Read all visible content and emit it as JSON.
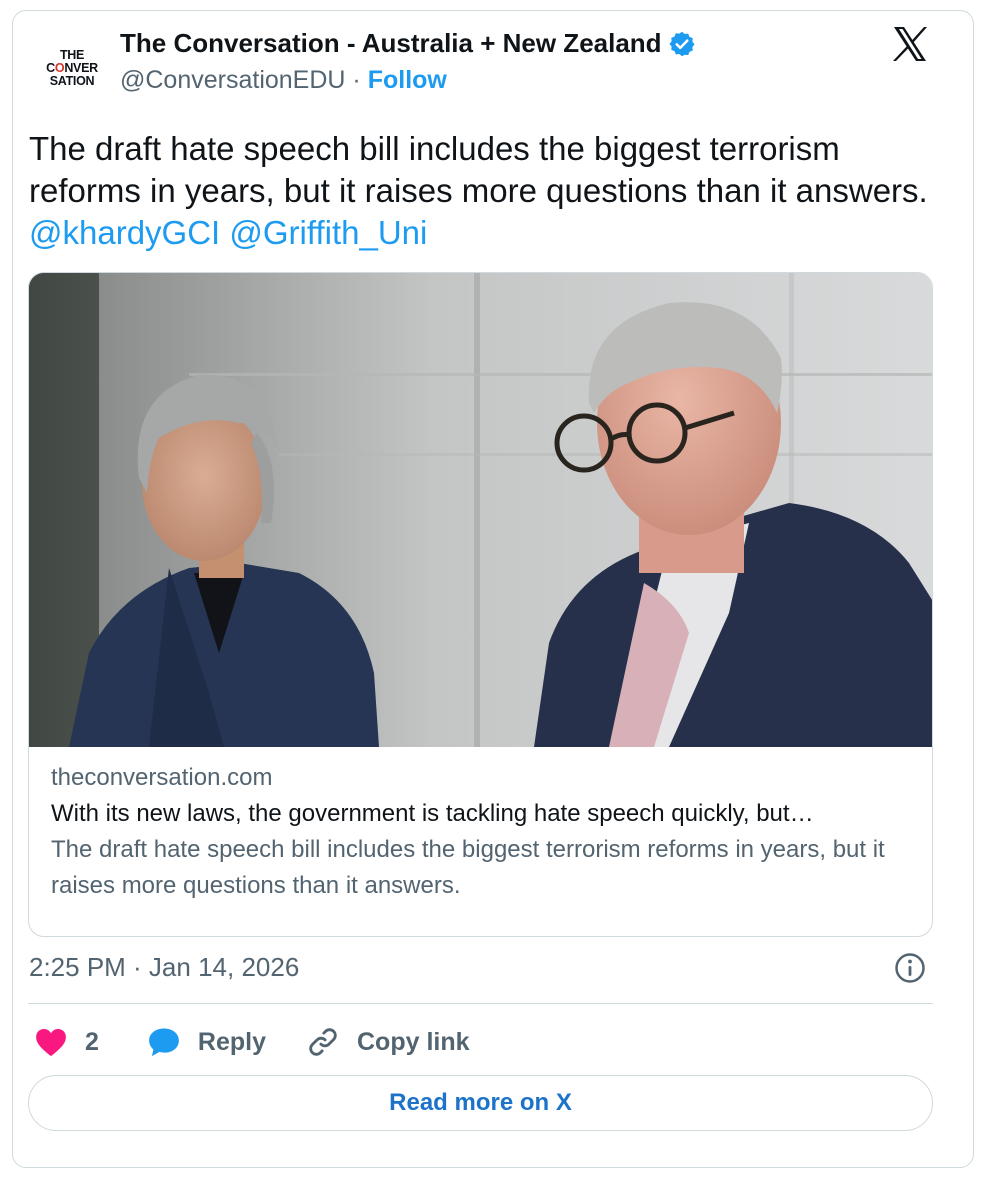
{
  "author": {
    "logo_lines": [
      "THE",
      "CONVER",
      "SATION"
    ],
    "name": "The Conversation - Australia + New Zealand",
    "handle": "@ConversationEDU",
    "separator": "·",
    "follow_label": "Follow"
  },
  "tweet": {
    "text": "The draft hate speech bill includes the biggest terrorism reforms in years, but it raises more questions than it answers.",
    "mentions": [
      "@khardyGCI",
      "@Griffith_Uni"
    ]
  },
  "link_card": {
    "domain": "theconversation.com",
    "headline": "With its new laws, the government is tackling hate speech quickly, but…",
    "description": "The draft hate speech bill includes the biggest terrorism reforms in years, but it raises more questions than it answers."
  },
  "timestamp": "2:25 PM · Jan 14, 2026",
  "actions": {
    "like_count": "2",
    "reply_label": "Reply",
    "copy_link_label": "Copy link"
  },
  "read_more_label": "Read more on X",
  "icons": {
    "verified": "verified-badge-icon",
    "brand": "x-logo-icon",
    "info": "info-icon",
    "like": "heart-icon",
    "reply": "speech-bubble-icon",
    "copy": "link-icon"
  },
  "colors": {
    "accent": "#1d9bf0",
    "like": "#f91880",
    "muted": "#536471",
    "border": "#cfd9de"
  }
}
